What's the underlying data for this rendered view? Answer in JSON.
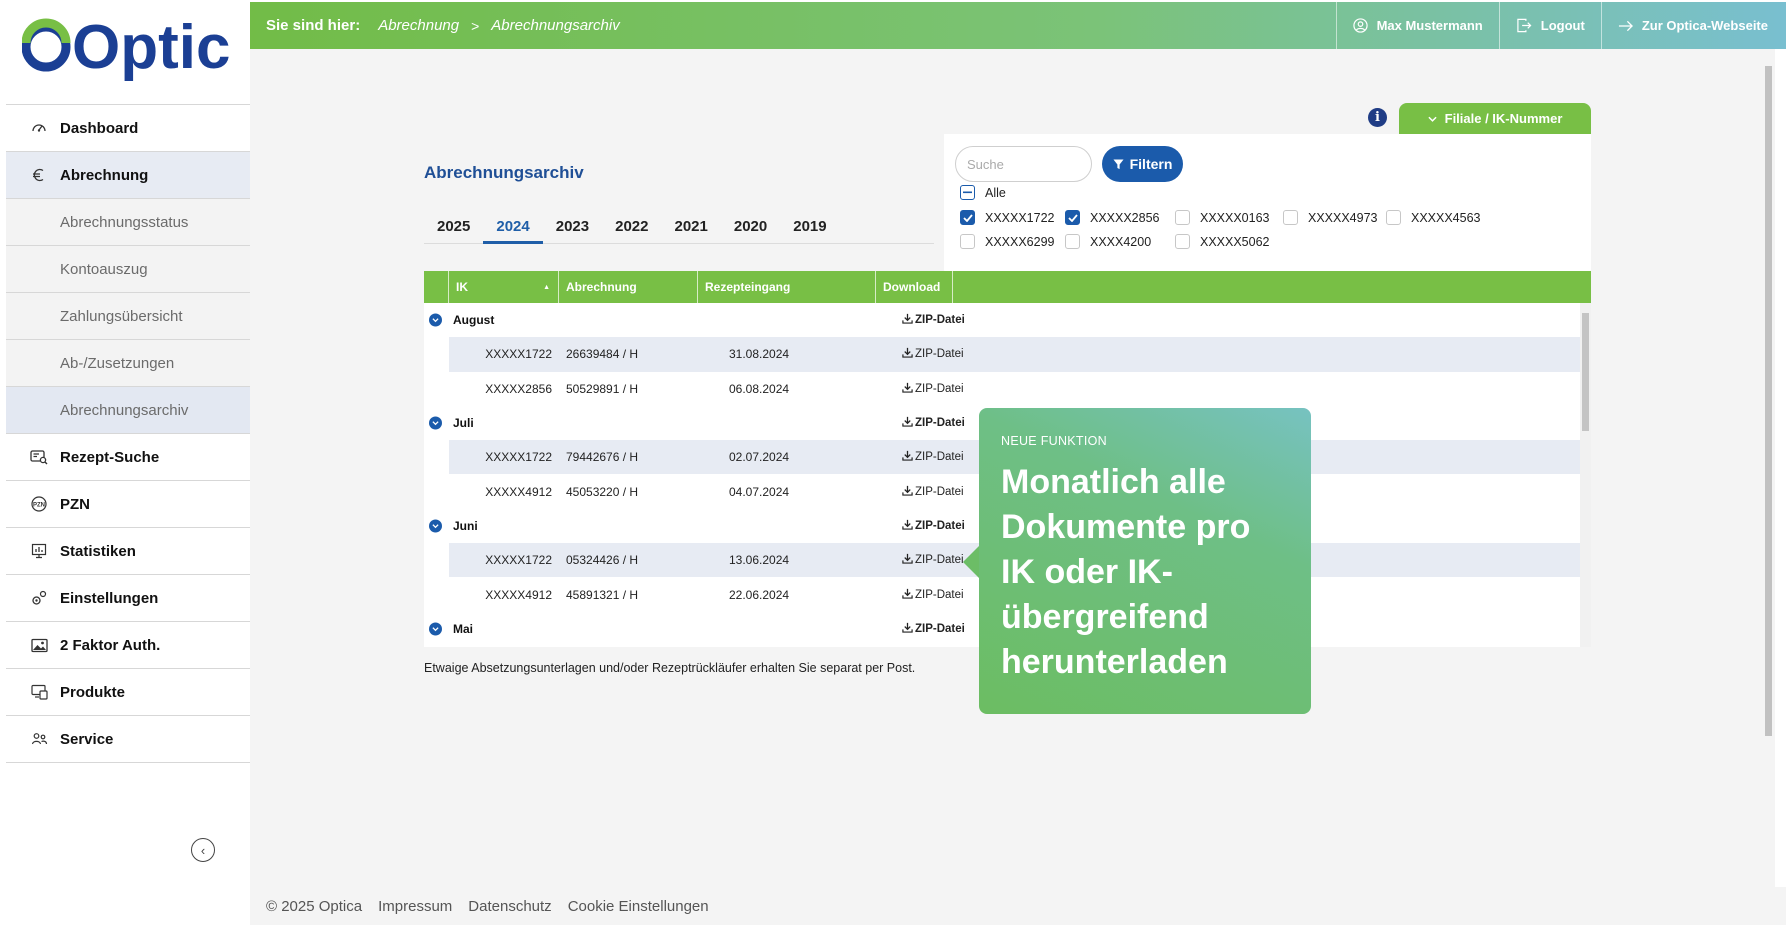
{
  "brand": {
    "name": "Optica",
    "color_green": "#78bf45",
    "color_blue": "#1b5bab"
  },
  "sidebar": {
    "items": [
      {
        "label": "Dashboard",
        "icon": "dashboard-icon"
      },
      {
        "label": "Abrechnung",
        "icon": "euro-icon",
        "active": true
      },
      {
        "label": "Abrechnungsstatus",
        "sub": true
      },
      {
        "label": "Kontoauszug",
        "sub": true
      },
      {
        "label": "Zahlungsübersicht",
        "sub": true
      },
      {
        "label": "Ab-/Zusetzungen",
        "sub": true
      },
      {
        "label": "Abrechnungsarchiv",
        "sub": true,
        "active": true
      },
      {
        "label": "Rezept-Suche",
        "icon": "prescription-search-icon"
      },
      {
        "label": "PZN",
        "icon": "pzn-icon"
      },
      {
        "label": "Statistiken",
        "icon": "statistics-icon"
      },
      {
        "label": "Einstellungen",
        "icon": "settings-icon"
      },
      {
        "label": "2 Faktor Auth.",
        "icon": "image-icon"
      },
      {
        "label": "Produkte",
        "icon": "products-icon"
      },
      {
        "label": "Service",
        "icon": "service-icon"
      }
    ]
  },
  "topbar": {
    "lead": "Sie sind hier:",
    "crumbs": [
      "Abrechnung",
      "Abrechnungsarchiv"
    ],
    "separator": ">",
    "user": "Max Mustermann",
    "logout": "Logout",
    "website": "Zur Optica-Webseite"
  },
  "main": {
    "title": "Abrechnungsarchiv",
    "years": [
      "2025",
      "2024",
      "2023",
      "2022",
      "2021",
      "2020",
      "2019"
    ],
    "active_year": "2024",
    "note": "Etwaige Absetzungsunterlagen und/oder Rezeptrückläufer erhalten Sie separat per Post."
  },
  "filter": {
    "tab_label": "Filiale / IK-Nummer",
    "search_placeholder": "Suche",
    "button_label": "Filtern",
    "all_label": "Alle",
    "options": [
      {
        "label": "XXXXX1722",
        "checked": true
      },
      {
        "label": "XXXXX2856",
        "checked": true
      },
      {
        "label": "XXXXX0163",
        "checked": false
      },
      {
        "label": "XXXXX4973",
        "checked": false
      },
      {
        "label": "XXXXX4563",
        "checked": false
      },
      {
        "label": "XXXXX6299",
        "checked": false
      },
      {
        "label": "XXXX4200",
        "checked": false
      },
      {
        "label": "XXXXX5062",
        "checked": false
      }
    ]
  },
  "table": {
    "columns": [
      "IK",
      "Abrechnung",
      "Rezepteingang",
      "Download"
    ],
    "download_label": "ZIP-Datei",
    "rows": [
      {
        "type": "group",
        "label": "August"
      },
      {
        "type": "data",
        "ik": "XXXXX1722",
        "abrechnung": "26639484 / H",
        "rezepteingang": "31.08.2024"
      },
      {
        "type": "data",
        "ik": "XXXXX2856",
        "abrechnung": "50529891 / H",
        "rezepteingang": "06.08.2024"
      },
      {
        "type": "group",
        "label": "Juli"
      },
      {
        "type": "data",
        "ik": "XXXXX1722",
        "abrechnung": "79442676 / H",
        "rezepteingang": "02.07.2024"
      },
      {
        "type": "data",
        "ik": "XXXXX4912",
        "abrechnung": "45053220 / H",
        "rezepteingang": "04.07.2024"
      },
      {
        "type": "group",
        "label": "Juni"
      },
      {
        "type": "data",
        "ik": "XXXXX1722",
        "abrechnung": "05324426 / H",
        "rezepteingang": "13.06.2024"
      },
      {
        "type": "data",
        "ik": "XXXXX4912",
        "abrechnung": "45891321 / H",
        "rezepteingang": "22.06.2024"
      },
      {
        "type": "group",
        "label": "Mai"
      }
    ]
  },
  "callout": {
    "kicker": "NEUE FUNKTION",
    "text": "Monatlich alle Dokumente pro IK oder IK-übergreifend herunterladen"
  },
  "footer": {
    "copyright": "© 2025 Optica",
    "links": [
      "Impressum",
      "Datenschutz",
      "Cookie Einstellungen"
    ]
  }
}
